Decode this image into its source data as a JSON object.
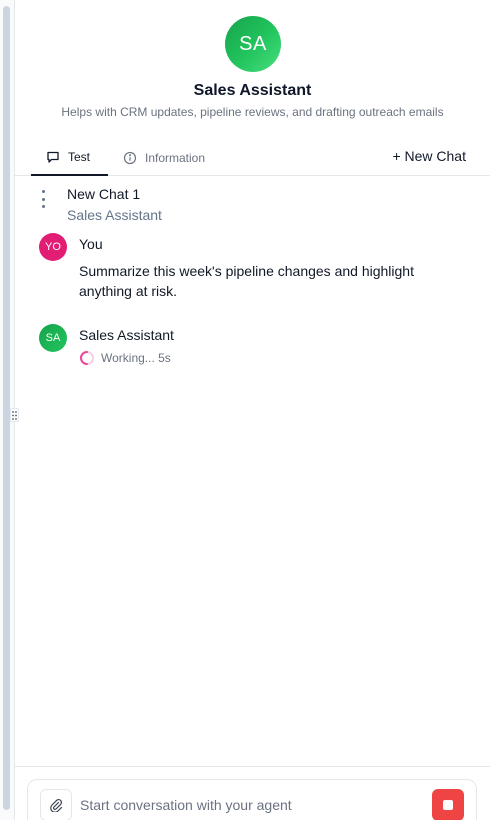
{
  "agent": {
    "initials": "SA",
    "name": "Sales Assistant",
    "description": "Helps with CRM updates, pipeline reviews, and drafting outreach emails"
  },
  "tabs": [
    {
      "label": "Test",
      "icon": "chat-bubble-icon",
      "active": true
    },
    {
      "label": "Information",
      "icon": "info-circle-icon",
      "active": false
    }
  ],
  "new_chat_label": "+ New Chat",
  "chat": {
    "title": "New Chat 1",
    "agent_name": "Sales Assistant"
  },
  "messages": [
    {
      "author": "You",
      "initials": "YO",
      "text": "Summarize this week's pipeline changes and highlight anything at risk."
    },
    {
      "author": "Sales Assistant",
      "initials": "SA",
      "status": "Working... 5s"
    }
  ],
  "composer": {
    "placeholder": "Start conversation with your agent",
    "attach_icon": "paperclip-icon",
    "stop_icon": "stop-icon"
  },
  "colors": {
    "agent_avatar": "#22c55e",
    "user_avatar": "#e11d74",
    "stop_button": "#ef4444",
    "spinner": "#ec4899"
  }
}
